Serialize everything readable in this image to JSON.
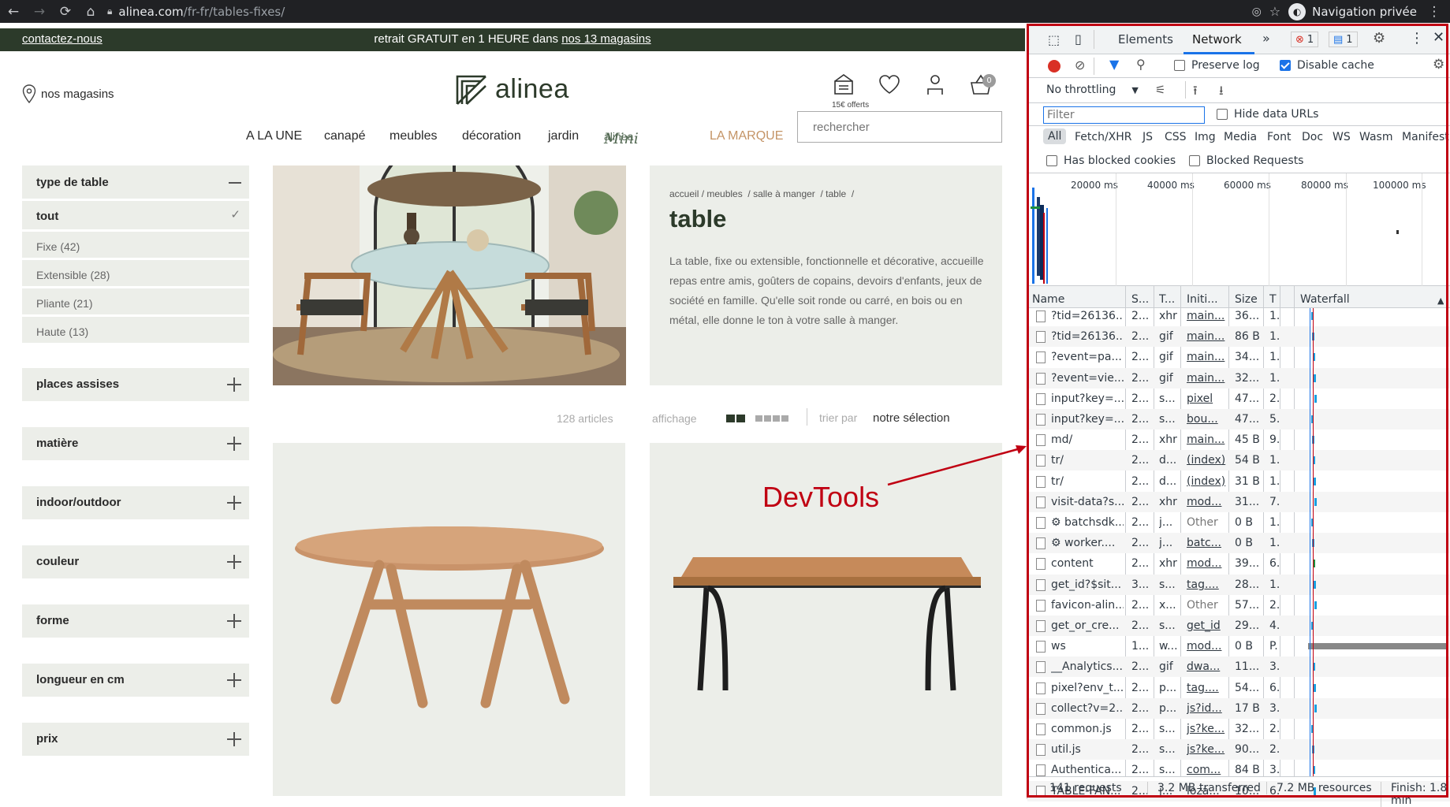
{
  "browser": {
    "url_domain": "alinea.com",
    "url_path": "/fr-fr/tables-fixes/",
    "private_label": "Navigation privée"
  },
  "site": {
    "contact": "contactez-nous",
    "promo_prefix": "retrait GRATUIT en 1 HEURE dans ",
    "promo_link": "nos 13 magasins",
    "stores_label": "nos magasins",
    "logo_text": "alinea",
    "offer_text": "15€ offerts",
    "cart_count": "0",
    "search_placeholder": "rechercher",
    "nav": [
      "A LA UNE",
      "canapé",
      "meubles",
      "décoration",
      "jardin",
      "alinea",
      "Mini",
      "LA MARQUE"
    ]
  },
  "filters": {
    "type_title": "type de table",
    "type_options": [
      "tout",
      "Fixe (42)",
      "Extensible (28)",
      "Pliante (21)",
      "Haute (13)"
    ],
    "groups": [
      "places assises",
      "matière",
      "indoor/outdoor",
      "couleur",
      "forme",
      "longueur en cm",
      "prix"
    ]
  },
  "category": {
    "breadcrumbs": [
      "accueil",
      "meubles",
      "salle à manger",
      "table"
    ],
    "title": "table",
    "description": "La table, fixe ou extensible, fonctionnelle et décorative, accueille repas entre amis, goûters de copains, devoirs d'enfants, jeux de société en famille. Qu'elle soit ronde ou carré, en bois ou en métal, elle donne le ton à votre salle à manger."
  },
  "listing": {
    "count": "128 articles",
    "display_label": "affichage",
    "sort_label": "trier par",
    "sort_value": "notre sélection"
  },
  "devtools": {
    "tabs": [
      "Elements",
      "Network"
    ],
    "error_count": "1",
    "message_count": "1",
    "preserve_log": "Preserve log",
    "disable_cache": "Disable cache",
    "throttling": "No throttling",
    "filter_placeholder": "Filter",
    "hide_data_urls": "Hide data URLs",
    "types": [
      "All",
      "Fetch/XHR",
      "JS",
      "CSS",
      "Img",
      "Media",
      "Font",
      "Doc",
      "WS",
      "Wasm",
      "Manifest"
    ],
    "has_blocked_cookies": "Has blocked cookies",
    "blocked_requests": "Blocked Requests",
    "timeline_ticks": [
      "20000 ms",
      "40000 ms",
      "60000 ms",
      "80000 ms",
      "100000 ms"
    ],
    "columns": [
      "Name",
      "S...",
      "T...",
      "Initi...",
      "Size",
      "T",
      "Waterfall"
    ],
    "rows": [
      [
        "?tid=26136...",
        "2...",
        "xhr",
        "main...",
        "36...",
        "1."
      ],
      [
        "?tid=26136...",
        "2...",
        "gif",
        "main...",
        "86 B",
        "1."
      ],
      [
        "?event=pa...",
        "2...",
        "gif",
        "main...",
        "34...",
        "1."
      ],
      [
        "?event=vie...",
        "2...",
        "gif",
        "main...",
        "32...",
        "1."
      ],
      [
        "input?key=...",
        "2...",
        "s...",
        "pixel",
        "47...",
        "2."
      ],
      [
        "input?key=...",
        "2...",
        "s...",
        "bou...",
        "47...",
        "5."
      ],
      [
        "md/",
        "2...",
        "xhr",
        "main...",
        "45 B",
        "9."
      ],
      [
        "tr/",
        "2...",
        "d...",
        "(index)",
        "54 B",
        "1."
      ],
      [
        "tr/",
        "2...",
        "d...",
        "(index)",
        "31 B",
        "1."
      ],
      [
        "visit-data?s...",
        "2...",
        "xhr",
        "mod...",
        "31...",
        "7."
      ],
      [
        "⚙ batchsdk...",
        "2...",
        "j...",
        "Other",
        "0 B",
        "1."
      ],
      [
        "⚙ worker....",
        "2...",
        "j...",
        "batc...",
        "0 B",
        "1."
      ],
      [
        "content",
        "2...",
        "xhr",
        "mod...",
        "39...",
        "6."
      ],
      [
        "get_id?$sit...",
        "3...",
        "s...",
        "tag....",
        "28...",
        "1."
      ],
      [
        "favicon-alin...",
        "2...",
        "x...",
        "Other",
        "57...",
        "2."
      ],
      [
        "get_or_cre...",
        "2...",
        "s...",
        "get_id",
        "29...",
        "4."
      ],
      [
        "ws",
        "1...",
        "w...",
        "mod...",
        "0 B",
        "P."
      ],
      [
        "__Analytics...",
        "2...",
        "gif",
        "dwa...",
        "11...",
        "3."
      ],
      [
        "pixel?env_t...",
        "2...",
        "p...",
        "tag....",
        "54...",
        "6."
      ],
      [
        "collect?v=2...",
        "2...",
        "p...",
        "js?id...",
        "17 B",
        "3."
      ],
      [
        "common.js",
        "2...",
        "s...",
        "js?ke...",
        "32...",
        "2."
      ],
      [
        "util.js",
        "2...",
        "s...",
        "js?ke...",
        "90...",
        "2."
      ],
      [
        "Authentica...",
        "2...",
        "s...",
        "com...",
        "84 B",
        "3."
      ],
      [
        "TABLE-FAN...",
        "2...",
        "j...",
        "loza...",
        "10...",
        "6."
      ]
    ],
    "status": [
      "141 requests",
      "3.2 MB transferred",
      "7.2 MB resources",
      "Finish: 1.8 min"
    ]
  },
  "annotation": "DevTools"
}
